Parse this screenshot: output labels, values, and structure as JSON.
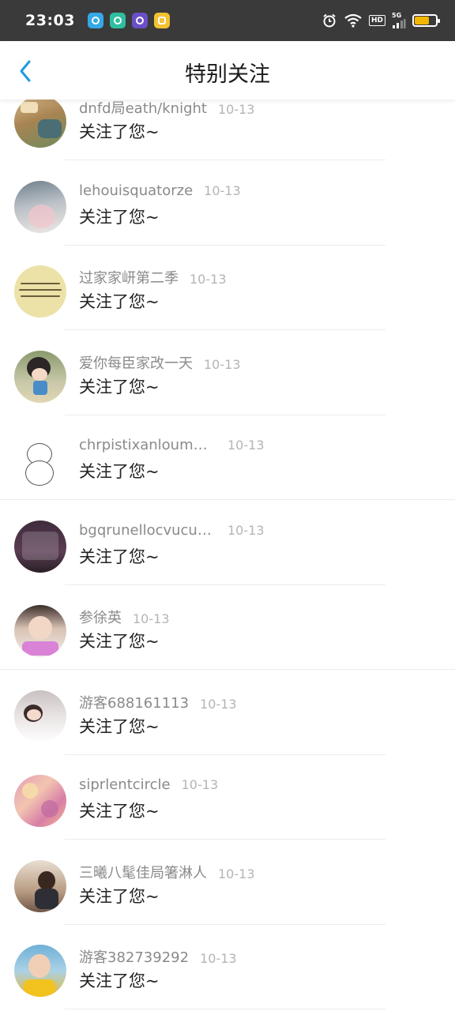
{
  "status_bar": {
    "time": "23:03",
    "hd": "HD",
    "network": "5G",
    "battery_level": 0.7,
    "app_icon_colors": [
      "#35a8e6",
      "#2fbf9f",
      "#6a4fc9",
      "#f2c230"
    ]
  },
  "header": {
    "title": "特别关注"
  },
  "items": [
    {
      "name": "dnfd局eath/knight",
      "date": "10-13",
      "action": "关注了您~"
    },
    {
      "name": "lehouisquatorze",
      "date": "10-13",
      "action": "关注了您~"
    },
    {
      "name": "过家家岍第二季",
      "date": "10-13",
      "action": "关注了您~"
    },
    {
      "name": "爱你每臣家改一天",
      "date": "10-13",
      "action": "关注了您~"
    },
    {
      "name": "chrpistixanloumoue",
      "date": "10-13",
      "action": "关注了您~"
    },
    {
      "name": "bgqrunellocvucugee",
      "date": "10-13",
      "action": "关注了您~"
    },
    {
      "name": "参徐英",
      "date": "10-13",
      "action": "关注了您~"
    },
    {
      "name": "游客688161113",
      "date": "10-13",
      "action": "关注了您~"
    },
    {
      "name": "siprlentcircle",
      "date": "10-13",
      "action": "关注了您~"
    },
    {
      "name": "三曦八髦佳局箸淋人",
      "date": "10-13",
      "action": "关注了您~"
    },
    {
      "name": "游客382739292",
      "date": "10-13",
      "action": "关注了您~"
    }
  ],
  "colors": {
    "accent": "#1e9be0",
    "status_bar_bg": "#3a3a3a",
    "name_color": "#8a8a8a",
    "date_color": "#b4b4b4",
    "action_color": "#222222"
  }
}
